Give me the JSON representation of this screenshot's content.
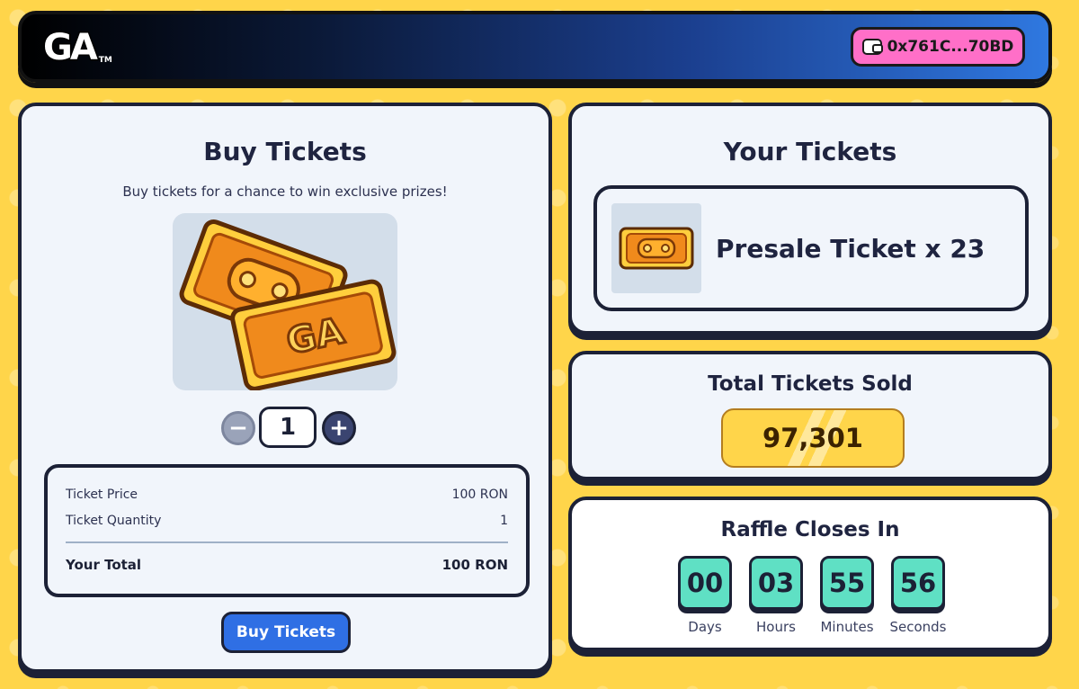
{
  "header": {
    "logo_text": "GA",
    "logo_tm": "TM",
    "wallet_address": "0x761C...70BD"
  },
  "buy_tickets": {
    "title": "Buy Tickets",
    "subtitle": "Buy tickets for a chance to win exclusive prizes!",
    "stepper": {
      "minus_label": "−",
      "plus_label": "+",
      "quantity": "1"
    },
    "summary": {
      "price_label": "Ticket Price",
      "price_value": "100 RON",
      "quantity_label": "Ticket Quantity",
      "quantity_value": "1",
      "total_label": "Your Total",
      "total_value": "100 RON"
    },
    "button_label": "Buy Tickets"
  },
  "your_tickets": {
    "title": "Your Tickets",
    "ticket_label": "Presale Ticket x 23"
  },
  "total_sold": {
    "title": "Total Tickets Sold",
    "value": "97,301"
  },
  "raffle": {
    "title": "Raffle Closes In",
    "countdown": [
      {
        "value": "00",
        "label": "Days"
      },
      {
        "value": "03",
        "label": "Hours"
      },
      {
        "value": "55",
        "label": "Minutes"
      },
      {
        "value": "56",
        "label": "Seconds"
      }
    ]
  },
  "colors": {
    "background": "#ffd54a",
    "wallet_button": "#ff6fc8",
    "buy_button": "#2f6fe4",
    "countdown_box": "#5fe0c4",
    "card_border": "#1c2136"
  }
}
